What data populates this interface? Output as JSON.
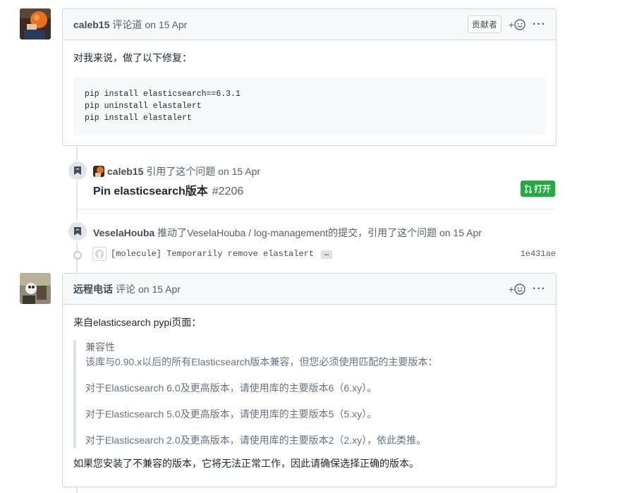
{
  "comment1": {
    "author": "caleb15",
    "action": "评论道",
    "date": "on 15 Apr",
    "badge": "贡献者",
    "reaction_plus": "+",
    "menu": "···",
    "intro": "对我来说，做了以下修复：",
    "code": "pip install elasticsearch==6.3.1\npip uninstall elastalert\npip install elastalert"
  },
  "event1": {
    "author": "caleb15",
    "action": "引用了这个问题",
    "date": "on 15 Apr",
    "pr_title": "Pin elasticsearch版本",
    "pr_number": "#2206",
    "state": "打开",
    "state_color": "#28a745"
  },
  "event2": {
    "author": "VeselaHouba",
    "action": "推动了VeselaHouba / log-management的提交，引用了这个问题",
    "date": "on 15 Apr",
    "commit_message": "[molecule] Temporarily remove elastalert",
    "commit_more": "…",
    "commit_sha": "1e431ae"
  },
  "comment2": {
    "author": "远程电话",
    "action": "评论",
    "date": "on 15 Apr",
    "reaction_plus": "+",
    "menu": "···",
    "intro": "来自elasticsearch pypi页面：",
    "quote": [
      "兼容性",
      "该库与0.90.x以后的所有Elasticsearch版本兼容，但您必须使用匹配的主要版本：",
      "对于Elasticsearch 6.0及更高版本，请使用库的主要版本6（6.xy）。",
      "对于Elasticsearch 5.0及更高版本，请使用库的主要版本5（5.xy）。",
      "对于Elasticsearch 2.0及更高版本，请使用库的主要版本2（2.xy），依此类推。"
    ],
    "outro": "如果您安装了不兼容的版本，它将无法正常工作，因此请确保选择正确的版本。"
  },
  "colors": {
    "border": "#d1d5da",
    "header_bg": "#f6f8fa",
    "open_green": "#28a745",
    "muted_text": "#586069"
  }
}
